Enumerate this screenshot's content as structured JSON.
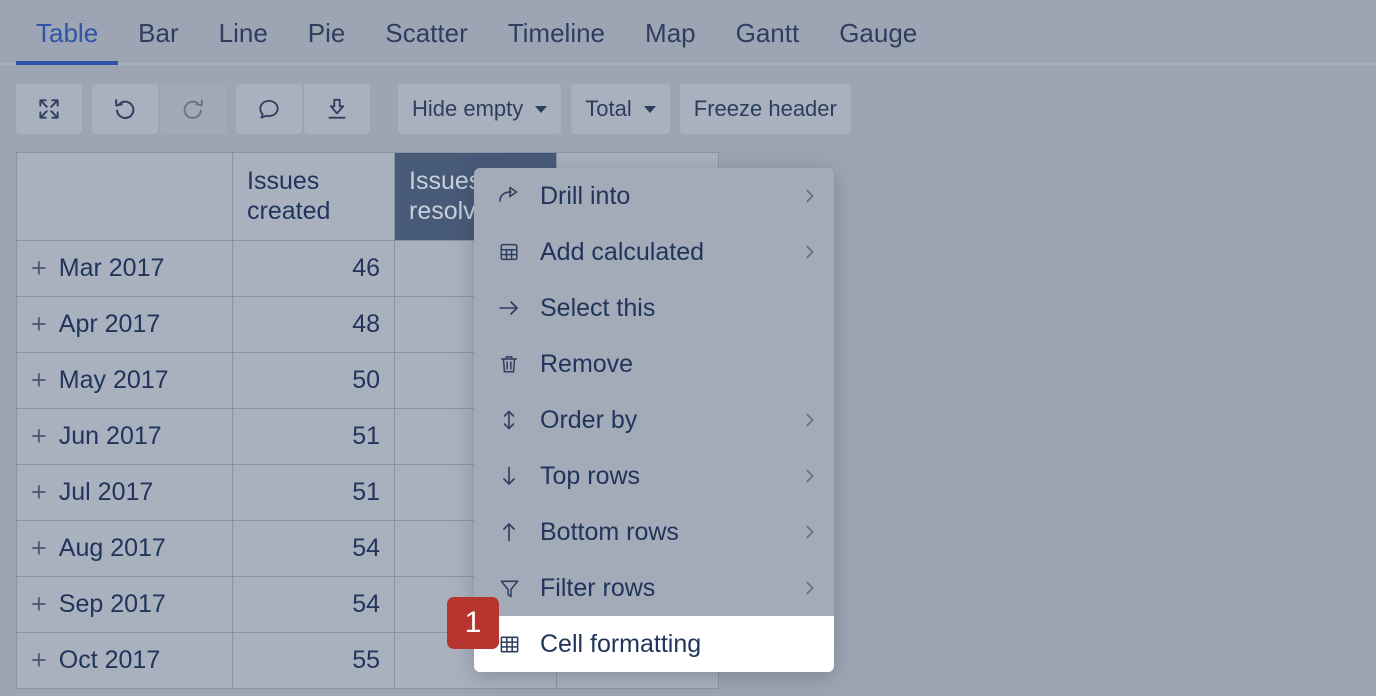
{
  "tabs": [
    {
      "label": "Table",
      "active": true
    },
    {
      "label": "Bar",
      "active": false
    },
    {
      "label": "Line",
      "active": false
    },
    {
      "label": "Pie",
      "active": false
    },
    {
      "label": "Scatter",
      "active": false
    },
    {
      "label": "Timeline",
      "active": false
    },
    {
      "label": "Map",
      "active": false
    },
    {
      "label": "Gantt",
      "active": false
    },
    {
      "label": "Gauge",
      "active": false
    }
  ],
  "toolbar": {
    "expand_icon": "expand-icon",
    "undo_icon": "undo-icon",
    "redo_icon": "redo-icon",
    "comment_icon": "comment-icon",
    "download_icon": "download-icon",
    "hide_empty_label": "Hide empty",
    "total_label": "Total",
    "freeze_header_label": "Freeze header"
  },
  "table": {
    "columns": [
      "",
      "Issues created",
      "Issues resolved",
      ""
    ],
    "selected_column_index": 2,
    "rows": [
      {
        "label": "Mar 2017",
        "issues_created": "46",
        "issues_resolved": "",
        "extra": ""
      },
      {
        "label": "Apr 2017",
        "issues_created": "48",
        "issues_resolved": "",
        "extra": ""
      },
      {
        "label": "May 2017",
        "issues_created": "50",
        "issues_resolved": "",
        "extra": ""
      },
      {
        "label": "Jun 2017",
        "issues_created": "51",
        "issues_resolved": "",
        "extra": ""
      },
      {
        "label": "Jul 2017",
        "issues_created": "51",
        "issues_resolved": "",
        "extra": ""
      },
      {
        "label": "Aug 2017",
        "issues_created": "54",
        "issues_resolved": "",
        "extra": ""
      },
      {
        "label": "Sep 2017",
        "issues_created": "54",
        "issues_resolved": "",
        "extra": ""
      },
      {
        "label": "Oct 2017",
        "issues_created": "55",
        "issues_resolved": "",
        "extra": ""
      }
    ],
    "expand_glyph": "+"
  },
  "context_menu": {
    "items": [
      {
        "label": "Drill into",
        "icon": "share-arrow-icon",
        "submenu": true,
        "highlighted": false
      },
      {
        "label": "Add calculated",
        "icon": "calculator-icon",
        "submenu": true,
        "highlighted": false
      },
      {
        "label": "Select this",
        "icon": "arrow-right-icon",
        "submenu": false,
        "highlighted": false
      },
      {
        "label": "Remove",
        "icon": "trash-icon",
        "submenu": false,
        "highlighted": false
      },
      {
        "label": "Order by",
        "icon": "sort-updown-icon",
        "submenu": true,
        "highlighted": false
      },
      {
        "label": "Top rows",
        "icon": "arrow-down-icon",
        "submenu": true,
        "highlighted": false
      },
      {
        "label": "Bottom rows",
        "icon": "arrow-up-icon",
        "submenu": true,
        "highlighted": false
      },
      {
        "label": "Filter rows",
        "icon": "funnel-icon",
        "submenu": true,
        "highlighted": false
      },
      {
        "label": "Cell formatting",
        "icon": "grid-icon",
        "submenu": false,
        "highlighted": true
      }
    ]
  },
  "step_badge": {
    "number": "1",
    "color": "#b8342f"
  },
  "colors": {
    "overlay_background": "#9da5b4",
    "surface": "#a9b1bf",
    "selected_header": "#475a78",
    "text": "#21355c",
    "accent": "#2c55a8",
    "highlight_row": "#ffffff"
  }
}
